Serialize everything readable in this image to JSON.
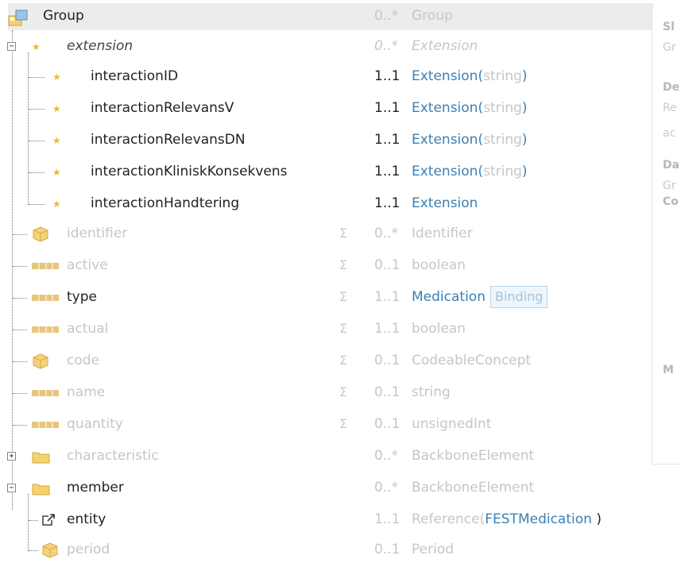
{
  "tree": [
    {
      "name": "Group",
      "card": "0..*",
      "sigma": "",
      "type": "Group",
      "type_parts": [],
      "state": "header"
    },
    {
      "name": "extension",
      "card": "0..*",
      "sigma": "",
      "type": "Extension",
      "type_parts": [],
      "state": "italic-dim"
    },
    {
      "name": "interactionID",
      "card": "1..1",
      "sigma": "",
      "type": "Extension",
      "type_parts": [
        "(",
        "string",
        ")"
      ],
      "state": "active"
    },
    {
      "name": "interactionRelevansV",
      "card": "1..1",
      "sigma": "",
      "type": "Extension",
      "type_parts": [
        "(",
        "string",
        ")"
      ],
      "state": "active"
    },
    {
      "name": "interactionRelevansDN",
      "card": "1..1",
      "sigma": "",
      "type": "Extension",
      "type_parts": [
        "(",
        "string",
        ")"
      ],
      "state": "active"
    },
    {
      "name": "interactionKliniskKonsekvens",
      "card": "1..1",
      "sigma": "",
      "type": "Extension",
      "type_parts": [
        "(",
        "string",
        ")"
      ],
      "state": "active"
    },
    {
      "name": "interactionHandtering",
      "card": "1..1",
      "sigma": "",
      "type": "Extension",
      "type_parts": [],
      "state": "active"
    },
    {
      "name": "identifier",
      "card": "0..*",
      "sigma": "Σ",
      "type": "Identifier",
      "type_parts": [],
      "state": "dim"
    },
    {
      "name": "active",
      "card": "0..1",
      "sigma": "Σ",
      "type": "boolean",
      "type_parts": [],
      "state": "dim"
    },
    {
      "name": "type",
      "card": "1..1",
      "sigma": "Σ",
      "type": "Medication",
      "type_parts": [],
      "binding": "Binding",
      "state": "active"
    },
    {
      "name": "actual",
      "card": "1..1",
      "sigma": "Σ",
      "type": "boolean",
      "type_parts": [],
      "state": "dim"
    },
    {
      "name": "code",
      "card": "0..1",
      "sigma": "Σ",
      "type": "CodeableConcept",
      "type_parts": [],
      "state": "dim"
    },
    {
      "name": "name",
      "card": "0..1",
      "sigma": "Σ",
      "type": "string",
      "type_parts": [],
      "state": "dim"
    },
    {
      "name": "quantity",
      "card": "0..1",
      "sigma": "Σ",
      "type": "unsignedInt",
      "type_parts": [],
      "state": "dim"
    },
    {
      "name": "characteristic",
      "card": "0..*",
      "sigma": "",
      "type": "BackboneElement",
      "type_parts": [],
      "state": "dim"
    },
    {
      "name": "member",
      "card": "0..*",
      "sigma": "",
      "type": "BackboneElement",
      "type_parts": [],
      "state": "active-dimtype"
    },
    {
      "name": "entity",
      "card": "1..1",
      "sigma": "",
      "type": "Reference",
      "type_parts": [
        "(",
        "FESTMedication",
        " )"
      ],
      "state": "active-dimtype"
    },
    {
      "name": "period",
      "card": "0..1",
      "sigma": "",
      "type": "Period",
      "type_parts": [],
      "state": "dim"
    }
  ],
  "side": {
    "labels": [
      "Sl",
      "De",
      "Da",
      "Co",
      "M"
    ],
    "texts": [
      "Gr",
      "Re",
      "ac",
      "Gr"
    ]
  },
  "colors": {
    "link": "#3a80b5",
    "dim": "#c6c6c6",
    "star": "#e8b93a",
    "folder": "#f5d26b",
    "element": "#e8c26a"
  },
  "icons": [
    "group-resource-icon",
    "star-extension-icon",
    "cube-datatype-icon",
    "primitive-icon",
    "folder-icon",
    "reference-icon",
    "tree-toggle-icon"
  ]
}
